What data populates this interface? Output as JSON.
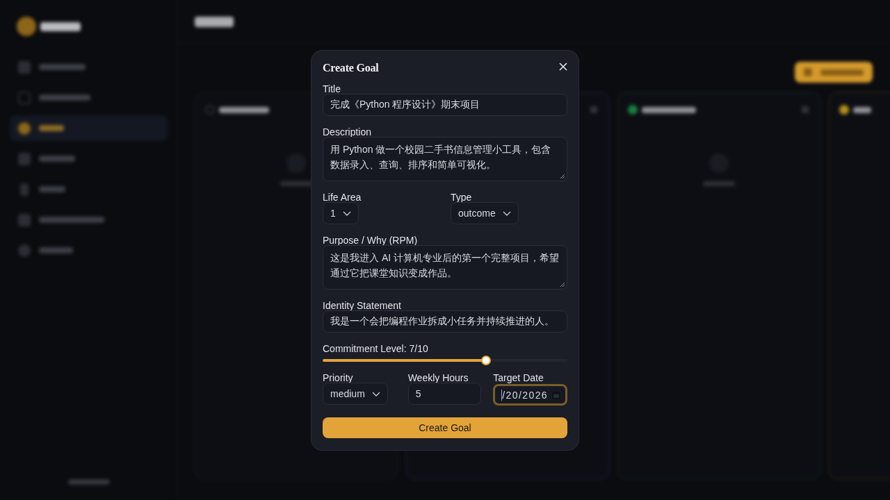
{
  "dialog": {
    "title": "Create Goal",
    "rows": [
      [
        {
          "kind": "text",
          "label": "Title",
          "value": "完成《Python 程序设计》期末项目"
        }
      ],
      [
        {
          "kind": "textarea",
          "label": "Description",
          "value": "用 Python 做一个校园二手书信息管理小工具，包含数据录入、查询、排序和简单可视化。"
        }
      ],
      [
        {
          "kind": "select",
          "label": "Life Area",
          "value": "1"
        },
        {
          "kind": "select",
          "label": "Type",
          "value": "outcome"
        }
      ],
      [
        {
          "kind": "textarea",
          "label": "Purpose / Why (RPM)",
          "value": "这是我进入 AI 计算机专业后的第一个完整项目，希望通过它把课堂知识变成作品。"
        }
      ],
      [
        {
          "kind": "text",
          "label": "Identity Statement",
          "value": "我是一个会把编程作业拆成小任务并持续推进的人。"
        }
      ],
      [
        {
          "kind": "slider",
          "label": "Commitment Level: 7/10",
          "level": 0.667
        }
      ],
      [
        {
          "kind": "select",
          "label": "Priority",
          "value": "medium"
        },
        {
          "kind": "number",
          "label": "Weekly Hours",
          "value": "5"
        },
        {
          "kind": "date",
          "label": "Target Date",
          "value": "/20/2026",
          "focused": true
        }
      ]
    ],
    "submit": "Create Goal"
  }
}
